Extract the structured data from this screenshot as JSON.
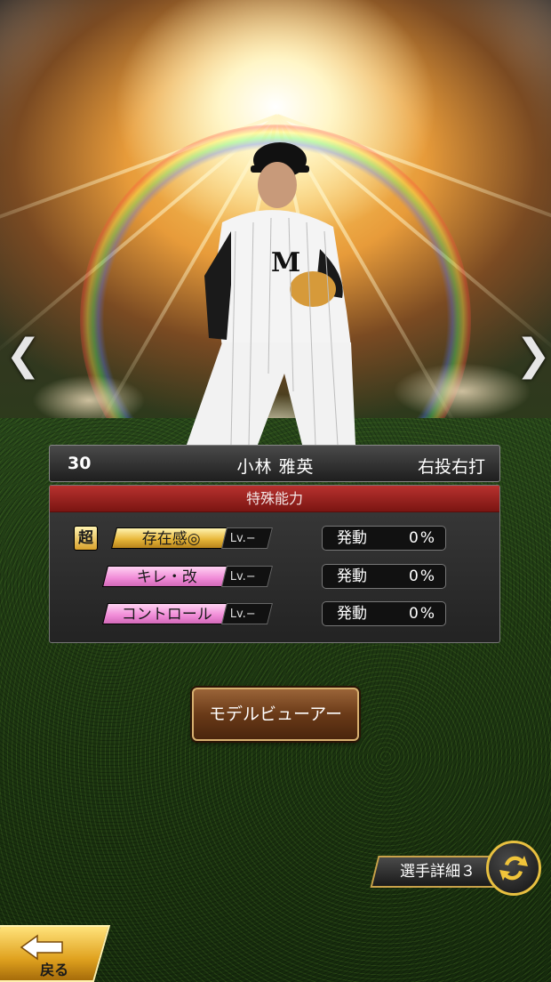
{
  "player": {
    "number": "30",
    "name": "小林 雅英",
    "throws_bats": "右投右打"
  },
  "abilities": {
    "header": "特殊能力",
    "trigger_label": "発動",
    "items": [
      {
        "prefix": "超",
        "name": "存在感◎",
        "level": "Lv.−",
        "rate": "0%",
        "color": "gold"
      },
      {
        "prefix": "",
        "name": "キレ・改",
        "level": "Lv.−",
        "rate": "0%",
        "color": "pink"
      },
      {
        "prefix": "",
        "name": "コントロール",
        "level": "Lv.−",
        "rate": "0%",
        "color": "pink"
      }
    ]
  },
  "buttons": {
    "model_viewer": "モデルビューアー",
    "detail": "選手詳細３",
    "back": "戻る",
    "prev": "❮",
    "next": "❯"
  },
  "colors": {
    "ability_header": "#b8322e",
    "gold_tag": "#e8b83a",
    "pink_tag": "#f08ad7",
    "button_border": "#d8b070"
  }
}
